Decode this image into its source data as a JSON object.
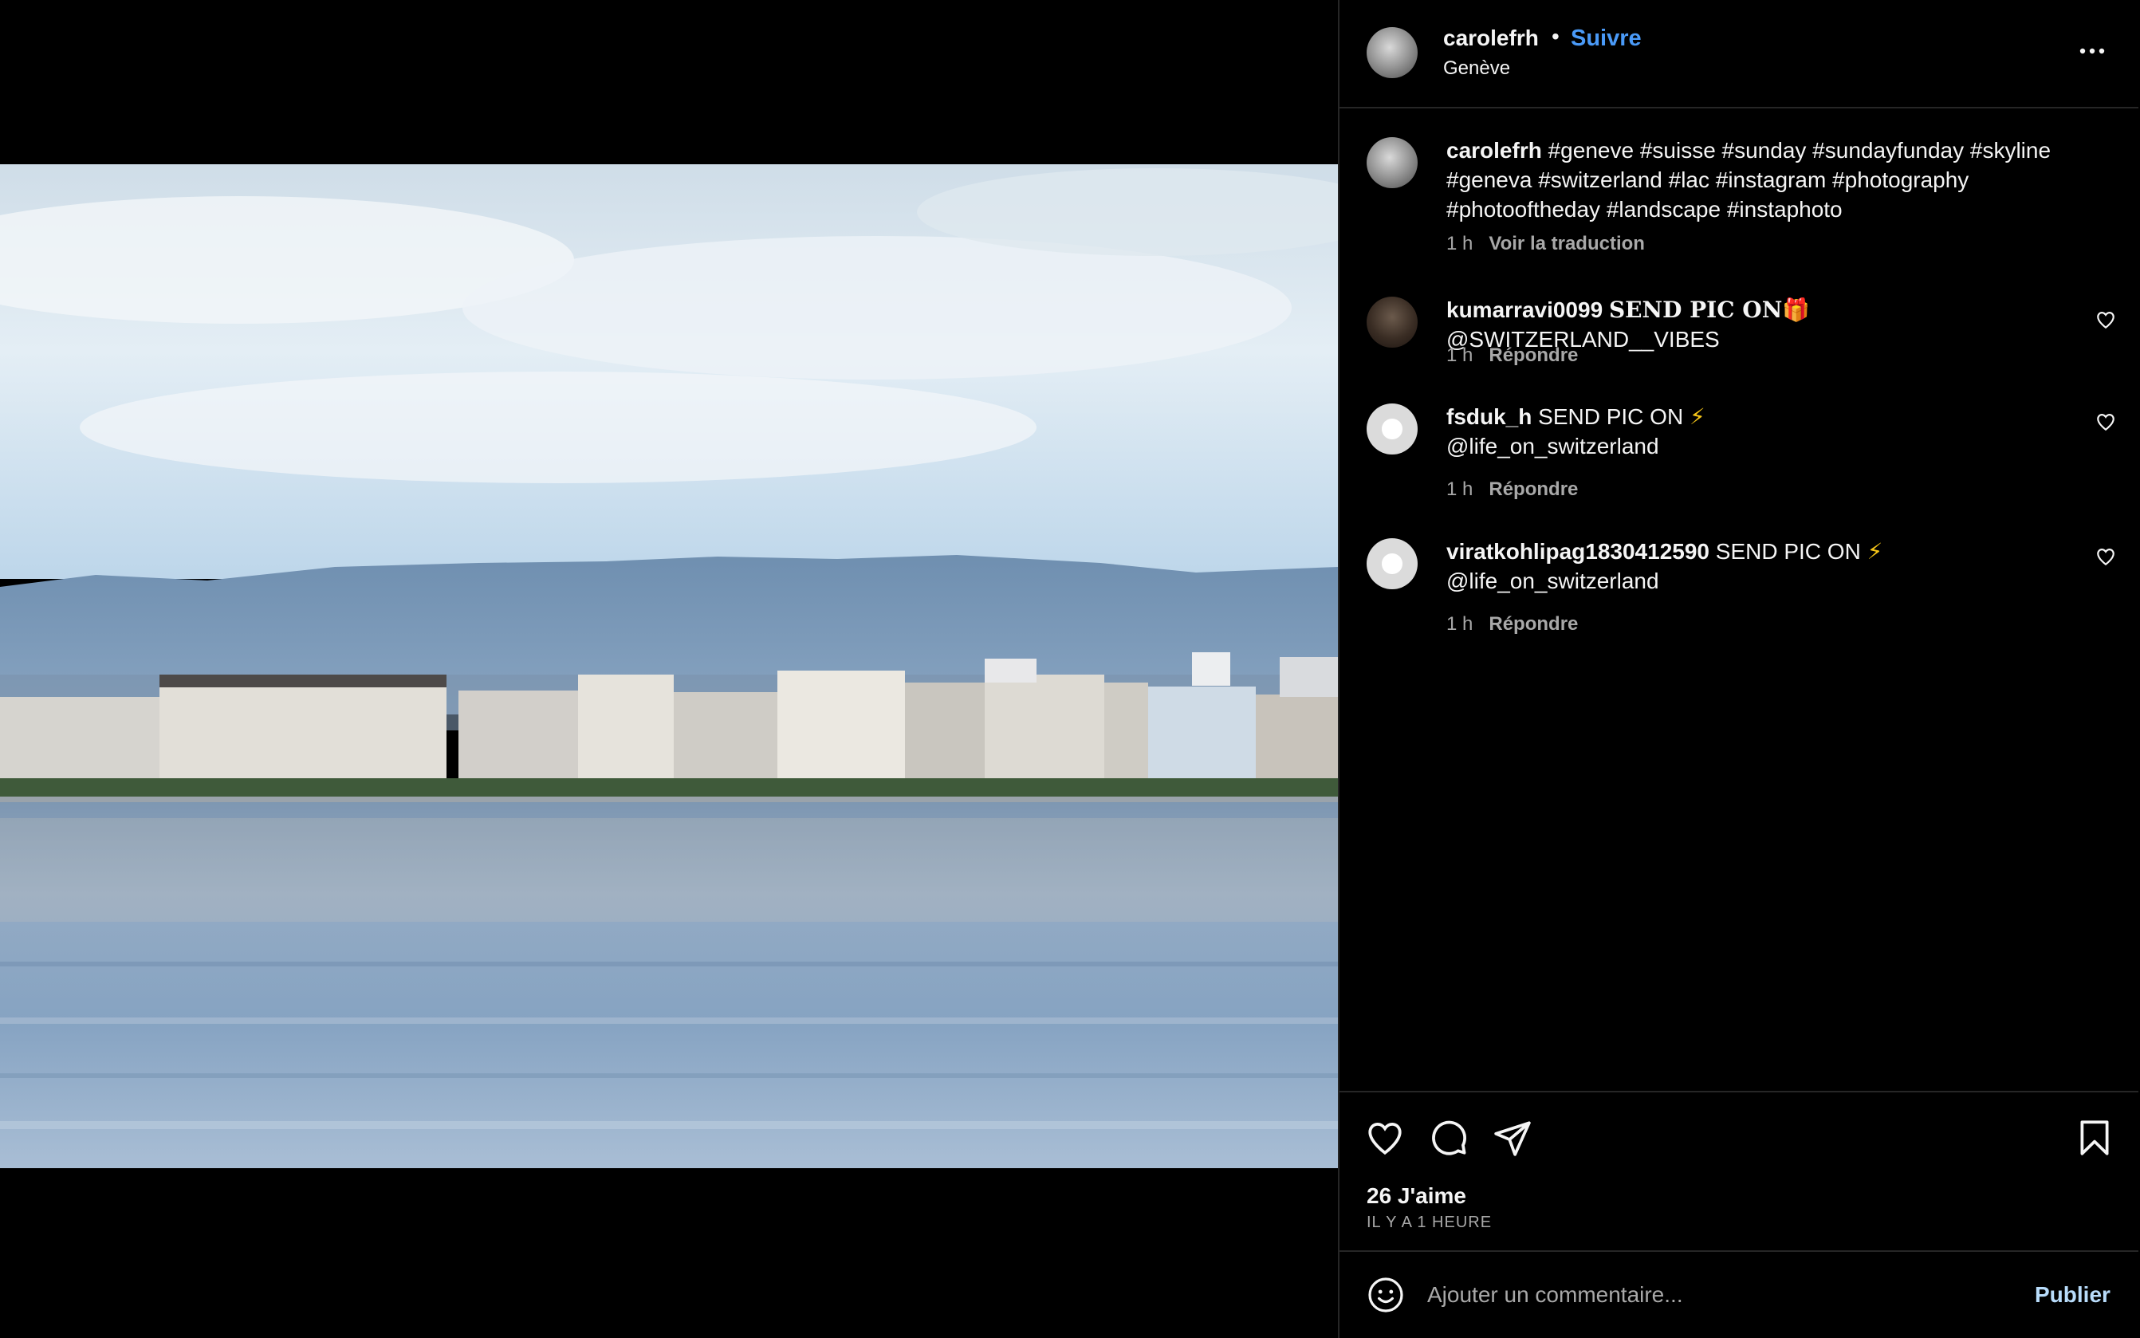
{
  "post": {
    "image_name": "geneva-lake-skyline-photo",
    "owner": {
      "username": "carolefrh",
      "separator": "•",
      "follow_label": "Suivre",
      "location": "Genève",
      "more_icon": "more-horizontal-icon"
    },
    "caption": {
      "username": "carolefrh",
      "text": "#geneve #suisse #sunday #sundayfunday #skyline #geneva #switzerland #lac #instagram #photography #photooftheday #landscape #instaphoto",
      "time": "1 h",
      "translate_label": "Voir la traduction"
    },
    "comments": [
      {
        "username": "kumarravi0099",
        "text_styled": "𝐒𝐄𝐍𝐃 𝐏𝐈𝐂 𝐎𝐍",
        "emoji": "🎁",
        "text_rest": "@SWITZERLAND__VIBES",
        "time": "1 h",
        "reply_label": "Répondre",
        "like_icon": "heart-outline-icon"
      },
      {
        "username": "fsduk_h",
        "text": "SEND PIC ON",
        "emoji": "⚡",
        "text_rest": "@life_on_switzerland",
        "time": "1 h",
        "reply_label": "Répondre",
        "like_icon": "heart-outline-icon"
      },
      {
        "username": "viratkohlipag1830412590",
        "text": "SEND PIC ON",
        "emoji": "⚡",
        "text_rest": "@life_on_switzerland",
        "time": "1 h",
        "reply_label": "Répondre",
        "like_icon": "heart-outline-icon"
      }
    ],
    "actions": {
      "like_icon": "heart-outline-icon",
      "comment_icon": "speech-bubble-icon",
      "share_icon": "paper-plane-icon",
      "save_icon": "bookmark-icon"
    },
    "likes_label": "26 J'aime",
    "time_ago": "IL Y A 1 HEURE",
    "comment_box": {
      "emoji_icon": "smiley-face-icon",
      "placeholder": "Ajouter un commentaire...",
      "publish_label": "Publier"
    }
  },
  "colors": {
    "background": "#000000",
    "text_primary": "#f5f5f5",
    "text_secondary": "#a8a8a8",
    "link_blue": "#4a9af7",
    "publish_disabled": "#b8dcfb",
    "divider": "#262626"
  }
}
